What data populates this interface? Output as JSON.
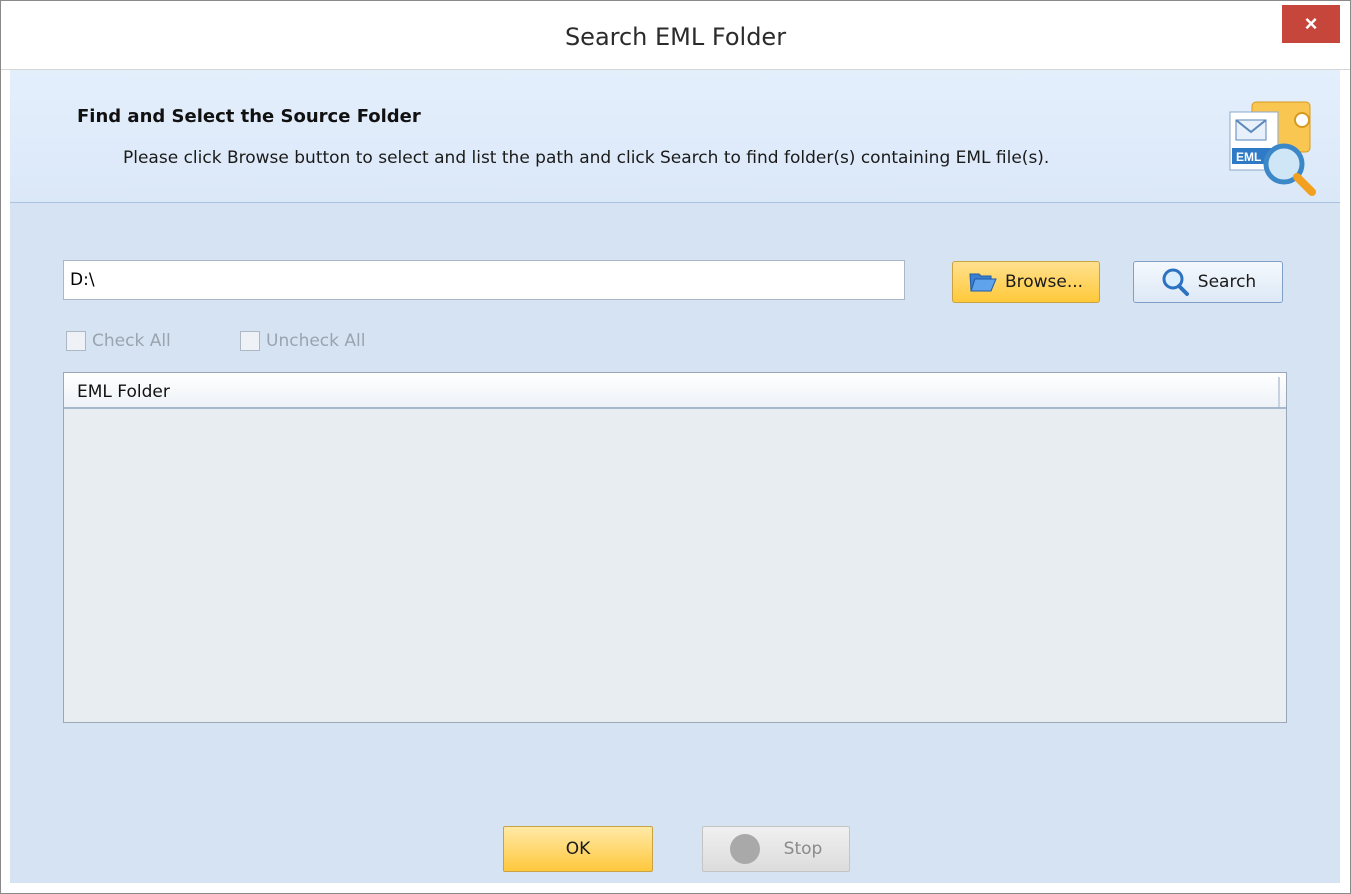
{
  "window": {
    "title": "Search EML Folder",
    "close_label": "×"
  },
  "header": {
    "title": "Find and Select the Source Folder",
    "subtitle": "Please click Browse button to select and list the path and click Search to find folder(s) containing EML file(s).",
    "icon": "eml-search-icon",
    "icon_label": "EML"
  },
  "path": {
    "value": "D:\\"
  },
  "buttons": {
    "browse": "Browse...",
    "search": "Search",
    "ok": "OK",
    "stop": "Stop"
  },
  "checks": {
    "check_all": "Check All",
    "uncheck_all": "Uncheck All"
  },
  "list": {
    "columns": [
      "EML Folder"
    ],
    "rows": []
  },
  "colors": {
    "accent": "#ffc93a",
    "close": "#c7463c",
    "body": "#d5e3f2"
  }
}
